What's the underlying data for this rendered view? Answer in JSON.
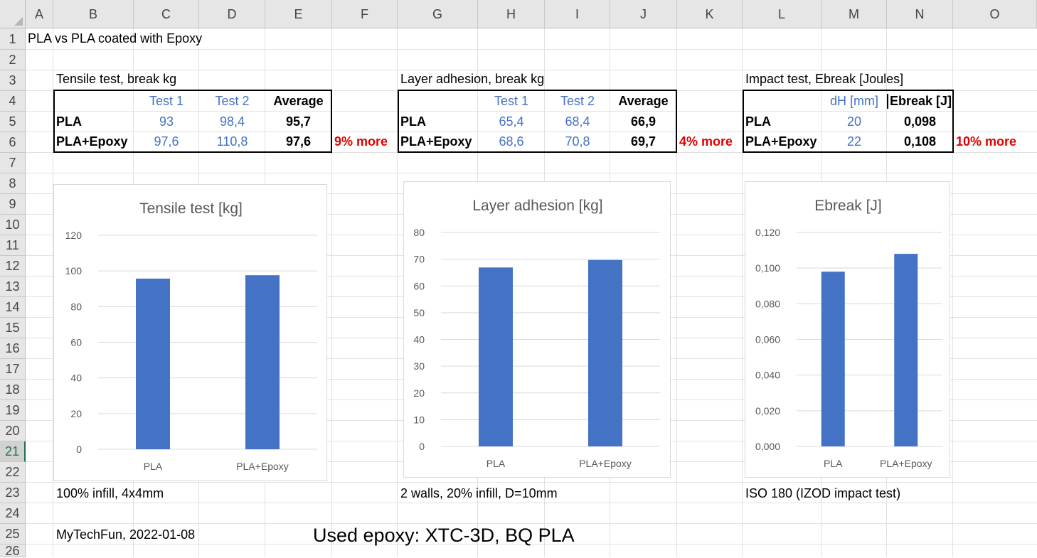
{
  "sheet": {
    "columns": [
      "A",
      "B",
      "C",
      "D",
      "E",
      "F",
      "G",
      "H",
      "I",
      "J",
      "K",
      "L",
      "M",
      "N",
      "O"
    ],
    "rows": [
      "1",
      "2",
      "3",
      "4",
      "5",
      "6",
      "7",
      "8",
      "9",
      "10",
      "11",
      "12",
      "13",
      "14",
      "15",
      "16",
      "17",
      "18",
      "19",
      "20",
      "21",
      "22",
      "23",
      "24",
      "25",
      "26"
    ],
    "selected_row": "21"
  },
  "cells": {
    "title": "PLA vs PLA coated with Epoxy",
    "tensile_heading": "Tensile test, break kg",
    "layer_heading": "Layer adhesion, break kg",
    "impact_heading": "Impact test, Ebreak [Joules]",
    "tensile_note": "100% infill, 4x4mm",
    "layer_note": "2 walls, 20% infill, D=10mm",
    "impact_note": "ISO 180 (IZOD impact test)",
    "credit": "MyTechFun, 2022-01-08",
    "epoxy_note": "Used epoxy: XTC-3D, BQ PLA"
  },
  "tables": {
    "tensile": {
      "headers": [
        "Test 1",
        "Test 2",
        "Average"
      ],
      "rows": [
        {
          "label": "PLA",
          "v1": "93",
          "v2": "98,4",
          "avg": "95,7"
        },
        {
          "label": "PLA+Epoxy",
          "v1": "97,6",
          "v2": "110,8",
          "avg": "97,6"
        }
      ],
      "diff": "9% more"
    },
    "layer": {
      "headers": [
        "Test 1",
        "Test 2",
        "Average"
      ],
      "rows": [
        {
          "label": "PLA",
          "v1": "65,4",
          "v2": "68,4",
          "avg": "66,9"
        },
        {
          "label": "PLA+Epoxy",
          "v1": "68,6",
          "v2": "70,8",
          "avg": "69,7"
        }
      ],
      "diff": "4% more"
    },
    "impact": {
      "headers": [
        "dH [mm]",
        "Ebreak [J]"
      ],
      "rows": [
        {
          "label": "PLA",
          "v1": "20",
          "avg": "0,098"
        },
        {
          "label": "PLA+Epoxy",
          "v1": "22",
          "avg": "0,108"
        }
      ],
      "diff": "10% more"
    }
  },
  "colors": {
    "bar": "#4472c4",
    "diff": "#e00000",
    "value": "#4472c4",
    "grid": "#d9d9d9",
    "axis_text": "#595959"
  },
  "chart_data": [
    {
      "type": "bar",
      "title": "Tensile test [kg]",
      "categories": [
        "PLA",
        "PLA+Epoxy"
      ],
      "values": [
        95.7,
        97.6
      ],
      "ylim": [
        0,
        120
      ],
      "yticks": [
        "0",
        "20",
        "40",
        "60",
        "80",
        "100",
        "120"
      ],
      "grid": true,
      "legend": "none"
    },
    {
      "type": "bar",
      "title": "Layer adhesion [kg]",
      "categories": [
        "PLA",
        "PLA+Epoxy"
      ],
      "values": [
        66.9,
        69.7
      ],
      "ylim": [
        0,
        80
      ],
      "yticks": [
        "0",
        "10",
        "20",
        "30",
        "40",
        "50",
        "60",
        "70",
        "80"
      ],
      "grid": true,
      "legend": "none"
    },
    {
      "type": "bar",
      "title": "Ebreak [J]",
      "categories": [
        "PLA",
        "PLA+Epoxy"
      ],
      "values": [
        0.098,
        0.108
      ],
      "ylim": [
        0,
        0.12
      ],
      "yticks": [
        "0,000",
        "0,020",
        "0,040",
        "0,060",
        "0,080",
        "0,100",
        "0,120"
      ],
      "grid": true,
      "legend": "none"
    }
  ]
}
